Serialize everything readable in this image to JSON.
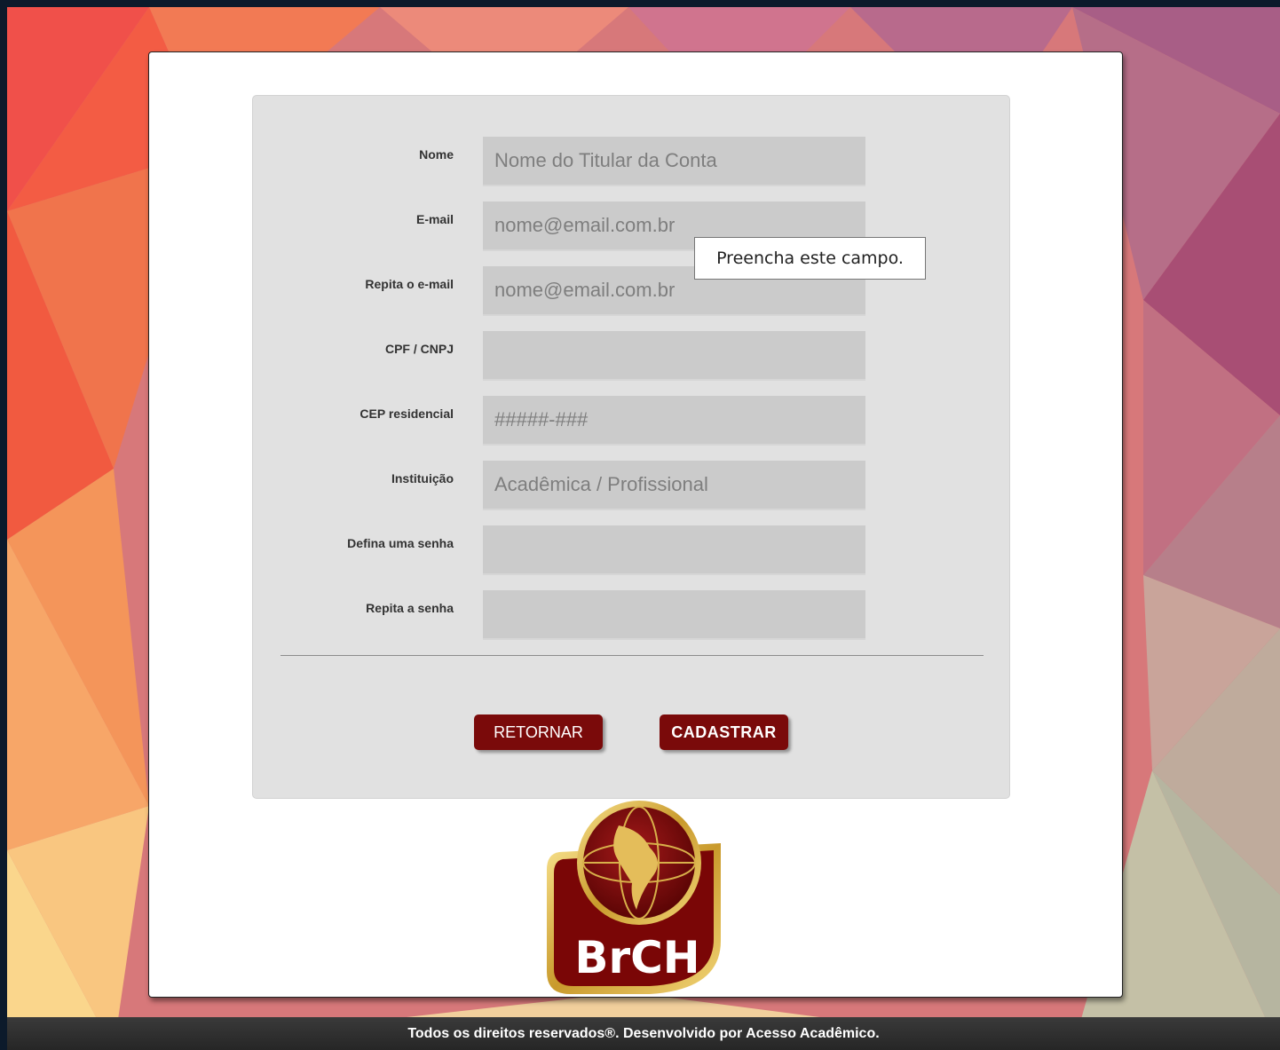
{
  "form": {
    "fields": [
      {
        "label": "Nome",
        "placeholder": "Nome do Titular da Conta",
        "value": "",
        "type": "text"
      },
      {
        "label": "E-mail",
        "placeholder": "nome@email.com.br",
        "value": "",
        "type": "email"
      },
      {
        "label": "Repita o e-mail",
        "placeholder": "nome@email.com.br",
        "value": "",
        "type": "email"
      },
      {
        "label": "CPF / CNPJ",
        "placeholder": "",
        "value": "",
        "type": "text"
      },
      {
        "label": "CEP residencial",
        "placeholder": "#####-###",
        "value": "",
        "type": "text"
      },
      {
        "label": "Instituição",
        "placeholder": "Acadêmica / Profissional",
        "value": "",
        "type": "text"
      },
      {
        "label": "Defina uma senha",
        "placeholder": "",
        "value": "",
        "type": "password"
      },
      {
        "label": "Repita a senha",
        "placeholder": "",
        "value": "",
        "type": "password"
      }
    ],
    "return_label": "RETORNAR",
    "submit_label": "CADASTRAR"
  },
  "tooltip": {
    "text": "Preencha este campo."
  },
  "logo": {
    "text": "BrCH"
  },
  "footer": {
    "text": "Todos os direitos reservados®. Desenvolvido por Acesso Acadêmico."
  },
  "colors": {
    "button": "#7a0a0a",
    "panel": "#e1e1e1",
    "input": "#cbcbcb"
  }
}
